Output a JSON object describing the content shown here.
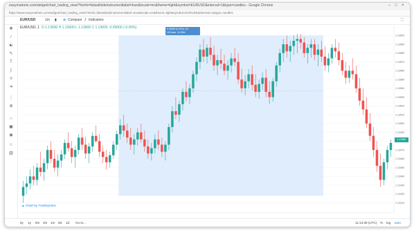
{
  "window": {
    "title": "easymarkets.com/widget/chart_trading_view/?tvinfo=false&hideinstrumentlabel=true&locale=en&theme=light&symbol=EURUSD&interval=1&type=candles - Google Chrome",
    "url": "https://www.easymarkets.com/widget/chart_trading_view/?tvinfo=false&hideinstrumentlabel=true&locale=en&theme=light&symbol=EURUSD&interval=1&type=candles"
  },
  "toolbar": {
    "symbol": "EUR/USD",
    "interval": "1m",
    "compare_label": "Compare",
    "indicators_label": "Indicators"
  },
  "legend": {
    "title": "EUR/USD, 1",
    "ohlc": "O 1.13600  H 1.13600  L 1.13600  C 1.13600  -0.00000 (-0.00%)"
  },
  "selection": {
    "line1": "0.00050 (0.04%), 50",
    "line2": "100 bars, 1h 39m"
  },
  "price_axis": {
    "current_price": "1.13580",
    "tick_labels": [
      "1.13600",
      "1.13590",
      "1.13580",
      "1.13570",
      "1.13560",
      "1.13550",
      "1.13540",
      "1.13530",
      "1.13520",
      "1.13510",
      "1.13500",
      "1.13490",
      "1.13480",
      "1.13470",
      "1.13460",
      "1.13450",
      "1.13440",
      "1.13430",
      "1.13420",
      "1.13410"
    ]
  },
  "logo_text": "Chart by TradingView",
  "time_ranges": [
    "5y",
    "1y",
    "6m",
    "3m",
    "1m",
    "5d",
    "1d"
  ],
  "goto_label": "Go to...",
  "footer": {
    "clock": "11:13:38 (UTC)",
    "percent": "%",
    "log": "log",
    "auto": "auto"
  },
  "colors": {
    "up": "#26a69a",
    "down": "#ef5350",
    "selection": "#dbeafc",
    "accent": "#4d8ed1"
  },
  "chart_data": {
    "type": "candlestick",
    "symbol": "EUR/USD",
    "interval": "1",
    "candles": [
      [
        1.13418,
        1.13435,
        1.1341,
        1.13428
      ],
      [
        1.13428,
        1.1344,
        1.1342,
        1.13432
      ],
      [
        1.13432,
        1.13448,
        1.13425,
        1.1344
      ],
      [
        1.1344,
        1.13452,
        1.1343,
        1.13436
      ],
      [
        1.13436,
        1.13455,
        1.1343,
        1.1345
      ],
      [
        1.1345,
        1.13468,
        1.1344,
        1.13445
      ],
      [
        1.13445,
        1.1346,
        1.13435,
        1.13455
      ],
      [
        1.13455,
        1.13475,
        1.13448,
        1.1347
      ],
      [
        1.1347,
        1.1348,
        1.13455,
        1.1346
      ],
      [
        1.1346,
        1.1347,
        1.13445,
        1.1345
      ],
      [
        1.1345,
        1.13465,
        1.1344,
        1.13458
      ],
      [
        1.13458,
        1.1347,
        1.1345,
        1.13465
      ],
      [
        1.13465,
        1.13482,
        1.1346,
        1.13478
      ],
      [
        1.13478,
        1.1349,
        1.13468,
        1.13472
      ],
      [
        1.13472,
        1.1348,
        1.13455,
        1.13462
      ],
      [
        1.13462,
        1.13475,
        1.1345,
        1.1347
      ],
      [
        1.1347,
        1.13488,
        1.13465,
        1.13484
      ],
      [
        1.13484,
        1.13495,
        1.1347,
        1.13476
      ],
      [
        1.13476,
        1.13485,
        1.1346,
        1.13466
      ],
      [
        1.13466,
        1.13478,
        1.13455,
        1.13474
      ],
      [
        1.13474,
        1.1349,
        1.13468,
        1.13486
      ],
      [
        1.13486,
        1.13498,
        1.13478,
        1.1348
      ],
      [
        1.1348,
        1.13488,
        1.13462,
        1.13468
      ],
      [
        1.13468,
        1.13475,
        1.13455,
        1.13462
      ],
      [
        1.13462,
        1.1347,
        1.13448,
        1.13456
      ],
      [
        1.13456,
        1.13468,
        1.1345,
        1.13464
      ],
      [
        1.13464,
        1.1348,
        1.1346,
        1.13476
      ],
      [
        1.13476,
        1.13492,
        1.1347,
        1.13488
      ],
      [
        1.13488,
        1.13505,
        1.13482,
        1.13498
      ],
      [
        1.13498,
        1.1351,
        1.13485,
        1.13492
      ],
      [
        1.13492,
        1.135,
        1.13478,
        1.13484
      ],
      [
        1.13484,
        1.13495,
        1.1347,
        1.13476
      ],
      [
        1.13476,
        1.13488,
        1.13465,
        1.13482
      ],
      [
        1.13482,
        1.13495,
        1.13475,
        1.1349
      ],
      [
        1.1349,
        1.135,
        1.13478,
        1.13482
      ],
      [
        1.13482,
        1.13492,
        1.13468,
        1.13474
      ],
      [
        1.13474,
        1.13482,
        1.1346,
        1.13466
      ],
      [
        1.13466,
        1.13478,
        1.13458,
        1.13472
      ],
      [
        1.13472,
        1.13488,
        1.13466,
        1.13482
      ],
      [
        1.13482,
        1.13492,
        1.1347,
        1.13476
      ],
      [
        1.13476,
        1.13484,
        1.13462,
        1.13468
      ],
      [
        1.13468,
        1.1348,
        1.13458,
        1.13476
      ],
      [
        1.13476,
        1.135,
        1.1347,
        1.13496
      ],
      [
        1.13496,
        1.1352,
        1.1349,
        1.13514
      ],
      [
        1.13514,
        1.1353,
        1.13505,
        1.1351
      ],
      [
        1.1351,
        1.13526,
        1.13502,
        1.13522
      ],
      [
        1.13522,
        1.1354,
        1.13515,
        1.13536
      ],
      [
        1.13536,
        1.13548,
        1.13525,
        1.1353
      ],
      [
        1.1353,
        1.13545,
        1.13522,
        1.1354
      ],
      [
        1.1354,
        1.1356,
        1.13535,
        1.13556
      ],
      [
        1.13556,
        1.13575,
        1.13548,
        1.1357
      ],
      [
        1.1357,
        1.1359,
        1.13562,
        1.13584
      ],
      [
        1.13584,
        1.13596,
        1.1357,
        1.13576
      ],
      [
        1.13576,
        1.1359,
        1.13568,
        1.13586
      ],
      [
        1.13586,
        1.13598,
        1.13572,
        1.13578
      ],
      [
        1.13578,
        1.13588,
        1.1356,
        1.13566
      ],
      [
        1.13566,
        1.13578,
        1.13555,
        1.13572
      ],
      [
        1.13572,
        1.13585,
        1.13562,
        1.13568
      ],
      [
        1.13568,
        1.13578,
        1.13555,
        1.1356
      ],
      [
        1.1356,
        1.13572,
        1.1355,
        1.13566
      ],
      [
        1.13566,
        1.1358,
        1.13558,
        1.13574
      ],
      [
        1.13574,
        1.13586,
        1.13565,
        1.1357
      ],
      [
        1.1357,
        1.1358,
        1.13545,
        1.1355
      ],
      [
        1.1355,
        1.13562,
        1.13535,
        1.1354
      ],
      [
        1.1354,
        1.13555,
        1.13532,
        1.13548
      ],
      [
        1.13548,
        1.13562,
        1.1354,
        1.13556
      ],
      [
        1.13556,
        1.13566,
        1.13538,
        1.13544
      ],
      [
        1.13544,
        1.13556,
        1.1353,
        1.13536
      ],
      [
        1.13536,
        1.1355,
        1.13528,
        1.13545
      ],
      [
        1.13545,
        1.13558,
        1.13538,
        1.13552
      ],
      [
        1.13552,
        1.13562,
        1.1353,
        1.13536
      ],
      [
        1.13536,
        1.13548,
        1.13522,
        1.1353
      ],
      [
        1.1353,
        1.13552,
        1.13525,
        1.13548
      ],
      [
        1.13548,
        1.1357,
        1.13542,
        1.13566
      ],
      [
        1.13566,
        1.13585,
        1.13558,
        1.1358
      ],
      [
        1.1358,
        1.13596,
        1.1357,
        1.1359
      ],
      [
        1.1359,
        1.136,
        1.13575,
        1.13582
      ],
      [
        1.13582,
        1.13594,
        1.1357,
        1.13588
      ],
      [
        1.13588,
        1.136,
        1.13578,
        1.13594
      ],
      [
        1.13594,
        1.13602,
        1.1358,
        1.13596
      ],
      [
        1.13596,
        1.13602,
        1.13585,
        1.13592
      ],
      [
        1.13592,
        1.13598,
        1.13575,
        1.1358
      ],
      [
        1.1358,
        1.1359,
        1.13568,
        1.13586
      ],
      [
        1.13586,
        1.13596,
        1.13575,
        1.1359
      ],
      [
        1.1359,
        1.13596,
        1.13572,
        1.13578
      ],
      [
        1.13578,
        1.1359,
        1.13565,
        1.13584
      ],
      [
        1.13584,
        1.13594,
        1.1357,
        1.13576
      ],
      [
        1.13576,
        1.13588,
        1.1356,
        1.13566
      ],
      [
        1.13566,
        1.1358,
        1.13558,
        1.13574
      ],
      [
        1.13574,
        1.1359,
        1.13568,
        1.13586
      ],
      [
        1.13586,
        1.13596,
        1.13575,
        1.13582
      ],
      [
        1.13582,
        1.13592,
        1.13566,
        1.13572
      ],
      [
        1.13572,
        1.1358,
        1.13555,
        1.1356
      ],
      [
        1.1356,
        1.1357,
        1.13545,
        1.13552
      ],
      [
        1.13552,
        1.13566,
        1.13546,
        1.1356
      ],
      [
        1.1356,
        1.13574,
        1.1355,
        1.13556
      ],
      [
        1.13556,
        1.13566,
        1.13535,
        1.1354
      ],
      [
        1.1354,
        1.13552,
        1.1352,
        1.13526
      ],
      [
        1.13526,
        1.1354,
        1.1351,
        1.13516
      ],
      [
        1.13516,
        1.1353,
        1.13495,
        1.135
      ],
      [
        1.135,
        1.13512,
        1.1348,
        1.13486
      ],
      [
        1.13486,
        1.13496,
        1.13462,
        1.1347
      ],
      [
        1.1347,
        1.1348,
        1.13445,
        1.13452
      ],
      [
        1.13452,
        1.13466,
        1.13428,
        1.13436
      ],
      [
        1.13436,
        1.1346,
        1.1343,
        1.13456
      ],
      [
        1.13456,
        1.13475,
        1.13448,
        1.1347
      ],
      [
        1.1347,
        1.13482,
        1.13462,
        1.13478
      ]
    ],
    "selection_range": {
      "from_index": 28,
      "to_index": 86
    },
    "ylim": [
      1.13405,
      1.13605
    ]
  }
}
